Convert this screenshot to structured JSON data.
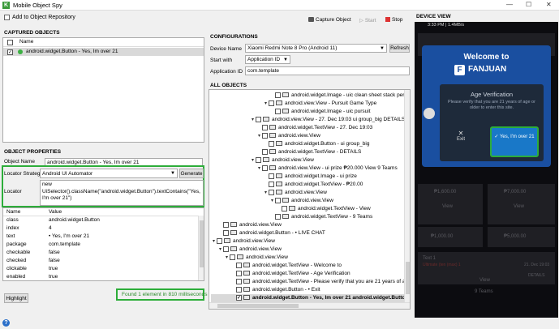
{
  "window": {
    "title": "Mobile Object Spy",
    "minimize": "—",
    "maximize": "☐",
    "close": "✕"
  },
  "toolbar": {
    "add_repo": "Add to Object Repository",
    "capture": "Capture Object",
    "start": "Start",
    "stop": "Stop"
  },
  "captured": {
    "title": "CAPTURED OBJECTS",
    "col_name": "Name",
    "item": "android.widget.Button - Yes, Im over 21"
  },
  "props": {
    "title": "OBJECT PROPERTIES",
    "object_name_label": "Object Name",
    "object_name_value": "android.widget.Button - Yes, Im over 21",
    "locator_strategy_label": "Locator Strategy",
    "locator_strategy_value": "Android UI Automator",
    "generate": "Generate",
    "locator_label": "Locator",
    "locator_value": "new UiSelector().className(\"android.widget.Button\").textContains(\"Yes, I'm over 21\")",
    "col_name": "Name",
    "col_value": "Value",
    "rows": [
      {
        "name": "class",
        "value": "android.widget.Button"
      },
      {
        "name": "index",
        "value": "4"
      },
      {
        "name": "text",
        "value": "• Yes, I'm over 21"
      },
      {
        "name": "package",
        "value": "com.template"
      },
      {
        "name": "checkable",
        "value": "false"
      },
      {
        "name": "checked",
        "value": "false"
      },
      {
        "name": "clickable",
        "value": "true"
      },
      {
        "name": "enabled",
        "value": "true"
      }
    ],
    "highlight": "Highlight",
    "found": "Found 1 element in 810 milliseconds"
  },
  "config": {
    "title": "CONFIGURATIONS",
    "device_label": "Device Name",
    "device_value": "Xiaomi Redmi Note 8 Pro (Android 11)",
    "refresh": "Refresh",
    "start_with_label": "Start with",
    "start_with_value": "Application ID",
    "app_id_label": "Application ID",
    "app_id_value": "com.template"
  },
  "tree": {
    "title": "ALL OBJECTS",
    "rows": [
      {
        "indent": 9,
        "tw": "",
        "text": "android.widget.Image - uic clean sheet stack penalty"
      },
      {
        "indent": 8,
        "tw": "▾",
        "text": "android.view.View - Pursuit Game Type"
      },
      {
        "indent": 9,
        "tw": "",
        "text": "android.widget.Image - uic pursuit"
      },
      {
        "indent": 6,
        "tw": "▾",
        "text": "android.view.View - 27. Dec 19:03 ui group_big DETAILS"
      },
      {
        "indent": 7,
        "tw": "",
        "text": "android.widget.TextView - 27. Dec 19:03"
      },
      {
        "indent": 7,
        "tw": "▾",
        "text": "android.view.View"
      },
      {
        "indent": 8,
        "tw": "",
        "text": "android.widget.Button - ui group_big"
      },
      {
        "indent": 7,
        "tw": "",
        "text": "android.widget.TextView - DETAILS"
      },
      {
        "indent": 6,
        "tw": "▾",
        "text": "android.view.View"
      },
      {
        "indent": 7,
        "tw": "▾",
        "text": "android.view.View - ui prize ₱20.000 View 9 Teams"
      },
      {
        "indent": 8,
        "tw": "",
        "text": "android.widget.Image - ui prize"
      },
      {
        "indent": 8,
        "tw": "",
        "text": "android.widget.TextView - ₱20.00"
      },
      {
        "indent": 8,
        "tw": "▾",
        "text": "android.view.View"
      },
      {
        "indent": 9,
        "tw": "▾",
        "text": "android.view.View"
      },
      {
        "indent": 10,
        "tw": "",
        "text": "android.widget.TextView - View"
      },
      {
        "indent": 9,
        "tw": "",
        "text": "android.widget.TextView - 9 Teams"
      },
      {
        "indent": 1,
        "tw": "",
        "text": "android.view.View"
      },
      {
        "indent": 1,
        "tw": "",
        "text": "android.widget.Button - • LIVE CHAT"
      },
      {
        "indent": 0,
        "tw": "▾",
        "text": "android.view.View"
      },
      {
        "indent": 1,
        "tw": "▾",
        "text": "android.view.View"
      },
      {
        "indent": 2,
        "tw": "▾",
        "text": "android.view.View"
      },
      {
        "indent": 3,
        "tw": "",
        "text": "android.widget.TextView - Welcome to"
      },
      {
        "indent": 3,
        "tw": "",
        "text": "android.widget.TextView - Age Verification"
      },
      {
        "indent": 3,
        "tw": "",
        "text": "android.widget.TextView - Please verify that you are 21 years of age or"
      },
      {
        "indent": 3,
        "tw": "",
        "text": "android.widget.Button - • Exit"
      },
      {
        "indent": 3,
        "tw": "",
        "text": "android.widget.Button - Yes, Im over 21 android.widget.Button - Y...",
        "selected": true
      }
    ]
  },
  "device": {
    "title": "DEVICE VIEW",
    "status": "3:33 PM | 1.4MB/s",
    "welcome": "Welcome to",
    "brand": "FANJUAN",
    "age_title": "Age Verification",
    "age_text": "Please verify that you are 21 years of age or older to enter this site.",
    "exit": "Exit",
    "yes": "Yes, I'm over 21",
    "bg": [
      "₱1,600.00",
      "₱7,000.00",
      "View",
      "View",
      "₱1,000.00",
      "₱5,000.00",
      "Text 1",
      "Ultimate (ten (max) 1",
      "21. Dec 19:03",
      "DETAILS",
      "View",
      "9 Teams"
    ]
  },
  "colors": {
    "accent": "#2dad3a",
    "modal_blue": "#1a4fa0",
    "yes_button": "#1978c8"
  }
}
